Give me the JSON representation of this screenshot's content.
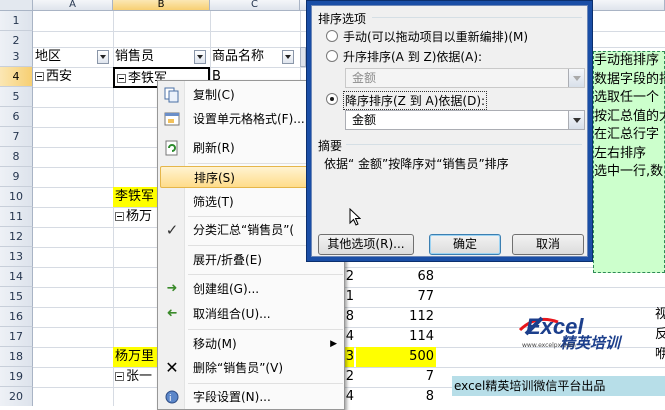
{
  "sheet": {
    "columns": [
      "A",
      "B",
      "C"
    ],
    "rows": [
      "1",
      "2",
      "3",
      "4",
      "5",
      "6",
      "7",
      "8",
      "9",
      "10",
      "11",
      "12",
      "13",
      "14",
      "15",
      "16",
      "17",
      "18",
      "19",
      "20",
      "21"
    ],
    "active_cell": "B4",
    "headers": {
      "region": "地区",
      "salesperson": "销售员",
      "product": "商品名称"
    },
    "cells": {
      "a4": "西安",
      "b4": "李铁军",
      "c4": "B",
      "b11": "李铁军",
      "b12": "杨万",
      "b19": "杨万里",
      "b20": "张一"
    },
    "colD": [
      "2",
      "1",
      "8",
      "4",
      "3",
      "2",
      "4",
      "8"
    ],
    "colE": [
      "68",
      "77",
      "112",
      "114",
      "500",
      "7",
      "8",
      "26"
    ],
    "right_chars": [
      "视",
      "反",
      "咿"
    ]
  },
  "context_menu": {
    "items": [
      {
        "label": "复制(C)",
        "icon": "copy-icon"
      },
      {
        "label": "设置单元格格式(F)...",
        "icon": "format-icon"
      },
      {
        "label": "刷新(R)",
        "icon": "refresh-icon"
      },
      {
        "label": "排序(S)",
        "icon": ""
      },
      {
        "label": "筛选(T)",
        "icon": ""
      },
      {
        "label": "分类汇总“销售员”(",
        "icon": "check-icon"
      },
      {
        "label": "展开/折叠(E)",
        "icon": ""
      },
      {
        "label": "创建组(G)...",
        "icon": "group-icon"
      },
      {
        "label": "取消组合(U)...",
        "icon": "ungroup-icon"
      },
      {
        "label": "移动(M)",
        "icon": ""
      },
      {
        "label": "删除“销售员”(V)",
        "icon": "delete-icon"
      },
      {
        "label": "字段设置(N)...",
        "icon": "field-settings-icon"
      }
    ]
  },
  "sort_dialog": {
    "group_title": "排序选项",
    "manual_label": "手动(可以拖动项目以重新编排)(M)",
    "asc_label": "升序排序(A 到 Z)依据(A):",
    "asc_field": "金额",
    "desc_label": "降序排序(Z 到 A)依据(D):",
    "desc_field": "金额",
    "summary_title": "摘要",
    "summary_text": "依据“ 金额”按降序对“销售员”排序",
    "more_options": "其他选项(R)...",
    "ok": "确定",
    "cancel": "取消"
  },
  "green_panel": {
    "lines": [
      "手动拖排序",
      "数据字段的排",
      "选取任一个",
      "按汇总值的大",
      "在汇总行字",
      "左右排序",
      "选中一行,数"
    ]
  },
  "logo": {
    "text_main": "Excel",
    "text_sub": "精英培训",
    "url": "www.excelpx.com"
  },
  "footer": {
    "text": "excel精英培训微信平台出品"
  },
  "colors": {
    "highlight_yellow": "#ffff00",
    "panel_green": "#ccffcc",
    "footer_blue": "#b7dee8",
    "dialog_border": "#1a4ea6"
  }
}
